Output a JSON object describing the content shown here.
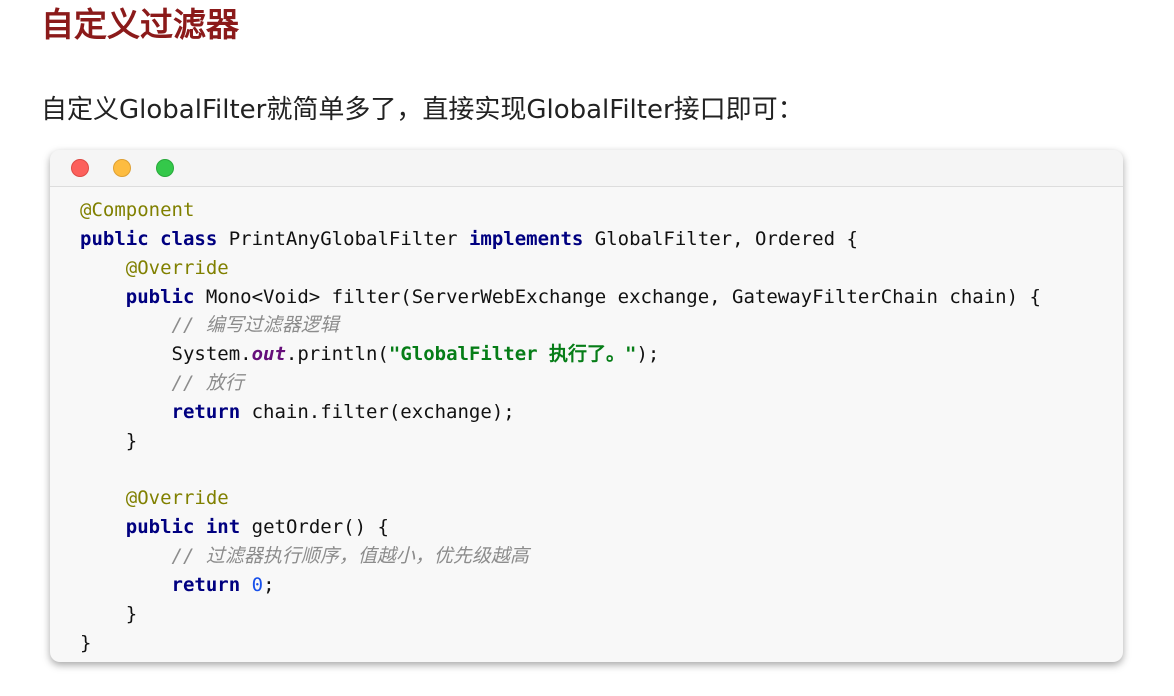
{
  "heading": "自定义过滤器",
  "intro": "自定义GlobalFilter就简单多了，直接实现GlobalFilter接口即可：",
  "window_controls": [
    "close",
    "minimize",
    "maximize"
  ],
  "code": {
    "language": "java",
    "lines": [
      {
        "indent": "",
        "tokens": [
          {
            "t": "@Component",
            "c": "ann"
          }
        ]
      },
      {
        "indent": "",
        "tokens": [
          {
            "t": "public",
            "c": "kw"
          },
          {
            "t": " "
          },
          {
            "t": "class",
            "c": "kw"
          },
          {
            "t": " PrintAnyGlobalFilter "
          },
          {
            "t": "implements",
            "c": "kw"
          },
          {
            "t": " GlobalFilter, Ordered {"
          }
        ]
      },
      {
        "indent": "    ",
        "tokens": [
          {
            "t": "@Override",
            "c": "ann"
          }
        ]
      },
      {
        "indent": "    ",
        "tokens": [
          {
            "t": "public",
            "c": "kw"
          },
          {
            "t": " Mono<Void> filter(ServerWebExchange exchange, GatewayFilterChain chain) {"
          }
        ]
      },
      {
        "indent": "        ",
        "tokens": [
          {
            "t": "// 编写过滤器逻辑",
            "c": "cm"
          }
        ]
      },
      {
        "indent": "        ",
        "tokens": [
          {
            "t": "System."
          },
          {
            "t": "out",
            "c": "fld"
          },
          {
            "t": ".println("
          },
          {
            "t": "\"GlobalFilter 执行了。\"",
            "c": "str"
          },
          {
            "t": ");"
          }
        ]
      },
      {
        "indent": "        ",
        "tokens": [
          {
            "t": "// 放行",
            "c": "cm"
          }
        ]
      },
      {
        "indent": "        ",
        "tokens": [
          {
            "t": "return",
            "c": "kw"
          },
          {
            "t": " chain.filter(exchange);"
          }
        ]
      },
      {
        "indent": "    ",
        "tokens": [
          {
            "t": "}"
          }
        ]
      },
      {
        "indent": "",
        "tokens": []
      },
      {
        "indent": "    ",
        "tokens": [
          {
            "t": "@Override",
            "c": "ann"
          }
        ]
      },
      {
        "indent": "    ",
        "tokens": [
          {
            "t": "public",
            "c": "kw"
          },
          {
            "t": " "
          },
          {
            "t": "int",
            "c": "kw"
          },
          {
            "t": " getOrder() {"
          }
        ]
      },
      {
        "indent": "        ",
        "tokens": [
          {
            "t": "// 过滤器执行顺序，值越小，优先级越高",
            "c": "cm"
          }
        ]
      },
      {
        "indent": "        ",
        "tokens": [
          {
            "t": "return",
            "c": "kw"
          },
          {
            "t": " "
          },
          {
            "t": "0",
            "c": "num"
          },
          {
            "t": ";"
          }
        ]
      },
      {
        "indent": "    ",
        "tokens": [
          {
            "t": "}"
          }
        ]
      },
      {
        "indent": "",
        "tokens": [
          {
            "t": "}"
          }
        ]
      }
    ]
  }
}
